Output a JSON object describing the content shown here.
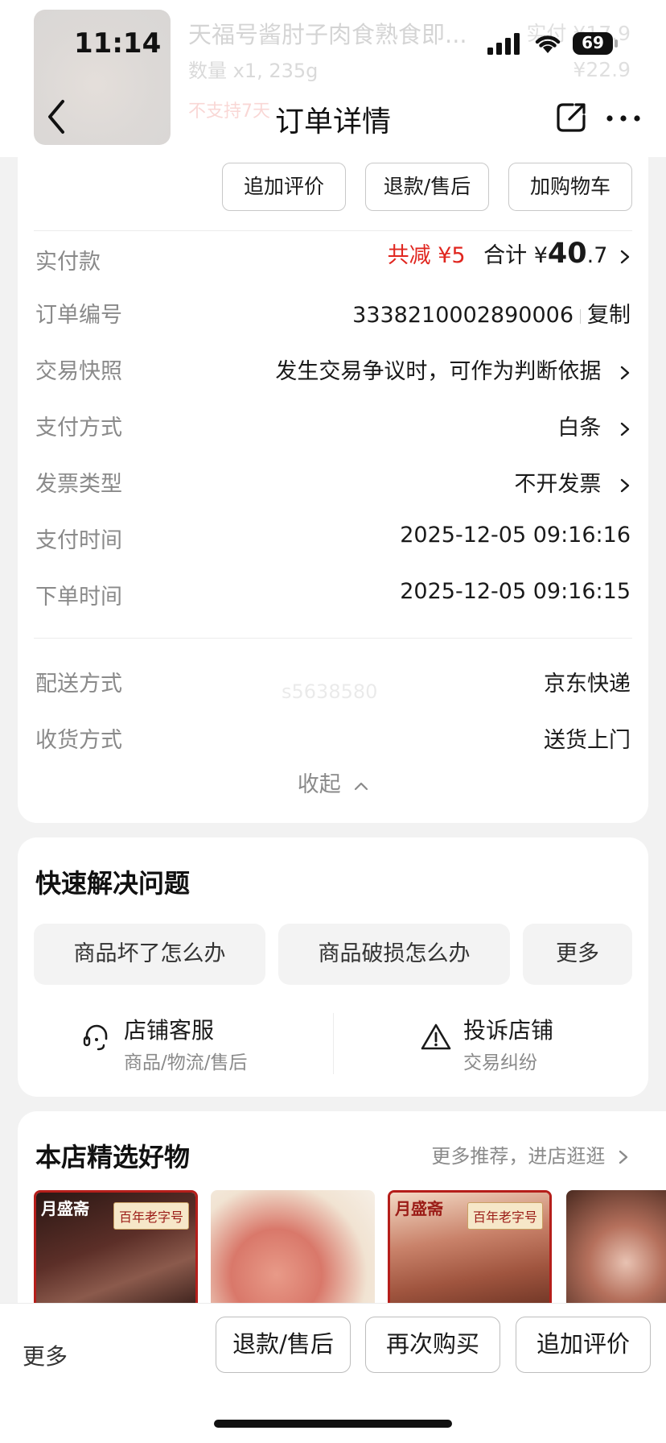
{
  "status_bar": {
    "time": "11:14",
    "battery": "69"
  },
  "background_product": {
    "title": "天福号酱肘子肉食熟食即...",
    "quantity": "数量 x1, 235g",
    "policy": "不支持7天",
    "price_paid": "实付 ¥17.9",
    "price_original": "¥22.9"
  },
  "nav": {
    "title": "订单详情",
    "back_icon": "chevron-left-icon",
    "share_icon": "share-icon",
    "more_icon": "more-dots-icon"
  },
  "order_actions": [
    "追加评价",
    "退款/售后",
    "加购物车"
  ],
  "payment": {
    "label": "实付款",
    "discount": "共减 ¥5",
    "total_label": "合计 ¥",
    "total_int": "40",
    "total_dec": ".7"
  },
  "details": [
    {
      "label": "订单编号",
      "value": "3338210002890006",
      "action": "复制"
    },
    {
      "label": "交易快照",
      "value": "发生交易争议时，可作为判断依据"
    },
    {
      "label": "支付方式",
      "value": "白条"
    },
    {
      "label": "发票类型",
      "value": "不开发票"
    },
    {
      "label": "支付时间",
      "value": "2025-12-05 09:16:16"
    },
    {
      "label": "下单时间",
      "value": "2025-12-05 09:16:15"
    }
  ],
  "delivery": [
    {
      "label": "配送方式",
      "value": "京东快递"
    },
    {
      "label": "收货方式",
      "value": "送货上门"
    }
  ],
  "watermark": "s5638580",
  "collapse_label": "收起",
  "quick_solve": {
    "title": "快速解决问题",
    "chips": [
      "商品坏了怎么办",
      "商品破损怎么办",
      "更多"
    ],
    "services": [
      {
        "title": "店铺客服",
        "subtitle": "商品/物流/售后",
        "icon": "headset-icon"
      },
      {
        "title": "投诉店铺",
        "subtitle": "交易纠纷",
        "icon": "warning-icon"
      }
    ]
  },
  "recommend": {
    "title": "本店精选好物",
    "more": "更多推荐，进店逛逛",
    "items": [
      {
        "brand": "月盛斋",
        "badge": "百年老字号"
      },
      {
        "brand": "",
        "badge": ""
      },
      {
        "brand": "月盛斋",
        "badge": "百年老字号"
      },
      {
        "brand": "",
        "badge": ""
      }
    ]
  },
  "bottom_bar": {
    "more": "更多",
    "buttons": [
      "退款/售后",
      "再次购买",
      "追加评价"
    ]
  },
  "colors": {
    "accent_red": "#e0261f",
    "label_gray": "#8a8a8a",
    "background": "#f2f2f2"
  }
}
